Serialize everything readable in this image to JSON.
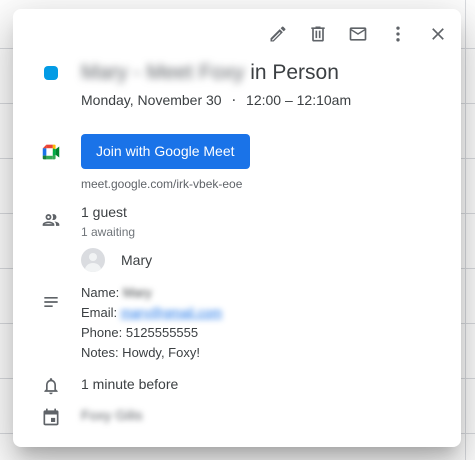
{
  "toolbar": {
    "edit_icon": "pencil-icon",
    "delete_icon": "trash-icon",
    "email_icon": "mail-icon",
    "more_icon": "more-vert-icon",
    "close_icon": "close-icon"
  },
  "event": {
    "color": "#039be5",
    "title_prefix": "Mary - Meet Foxy",
    "title_suffix": " in Person",
    "date": "Monday, November 30",
    "separator": "⋅",
    "time": "12:00 – 12:10am"
  },
  "meet": {
    "button_label": "Join with Google Meet",
    "link": "meet.google.com/irk-vbek-eoe"
  },
  "guests": {
    "count": "1 guest",
    "status": "1 awaiting",
    "list": [
      {
        "name": "Mary"
      }
    ]
  },
  "description": {
    "name_label": "Name: ",
    "name_value": "Mary",
    "email_label": "Email: ",
    "email_value": "mary@gmail.com",
    "phone": "Phone: 5125555555",
    "notes": "Notes: Howdy, Foxy!"
  },
  "reminder": {
    "text": "1 minute before"
  },
  "calendar": {
    "name": "Foxy Gilis"
  }
}
